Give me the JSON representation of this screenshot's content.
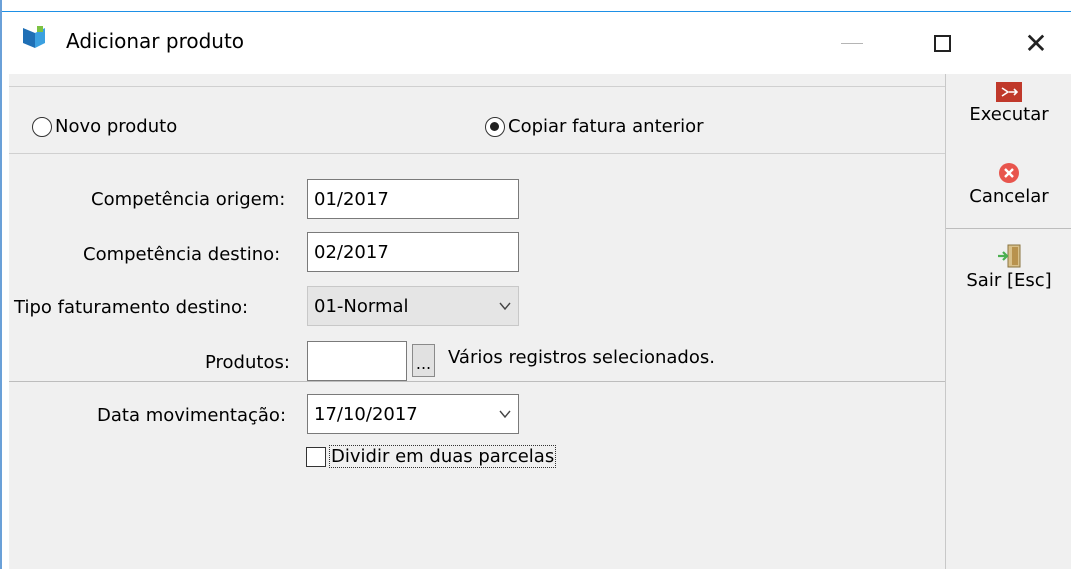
{
  "window": {
    "title": "Adicionar produto"
  },
  "mode": {
    "options": [
      {
        "label": "Novo produto",
        "selected": false
      },
      {
        "label": "Copiar fatura anterior",
        "selected": true
      }
    ]
  },
  "form": {
    "competencia_origem": {
      "label": "Competência origem:",
      "value": "01/2017"
    },
    "competencia_destino": {
      "label": "Competência destino:",
      "value": "02/2017"
    },
    "tipo_faturamento": {
      "label": "Tipo faturamento destino:",
      "value": "01-Normal"
    },
    "produtos": {
      "label": "Produtos:",
      "value": "",
      "browse_label": "...",
      "note": "Vários registros selecionados."
    },
    "data_movimentacao": {
      "label": "Data movimentação:",
      "value": "17/10/2017"
    },
    "dividir": {
      "label": "Dividir em duas parcelas",
      "checked": false
    }
  },
  "actions": {
    "executar": "Executar",
    "cancelar": "Cancelar",
    "sair": "Sair [Esc]"
  },
  "colors": {
    "accent_border": "#1e90e6",
    "executar_icon": "#c0392b",
    "cancelar_icon": "#e8554d",
    "sair_icon": "#6aa84f"
  }
}
